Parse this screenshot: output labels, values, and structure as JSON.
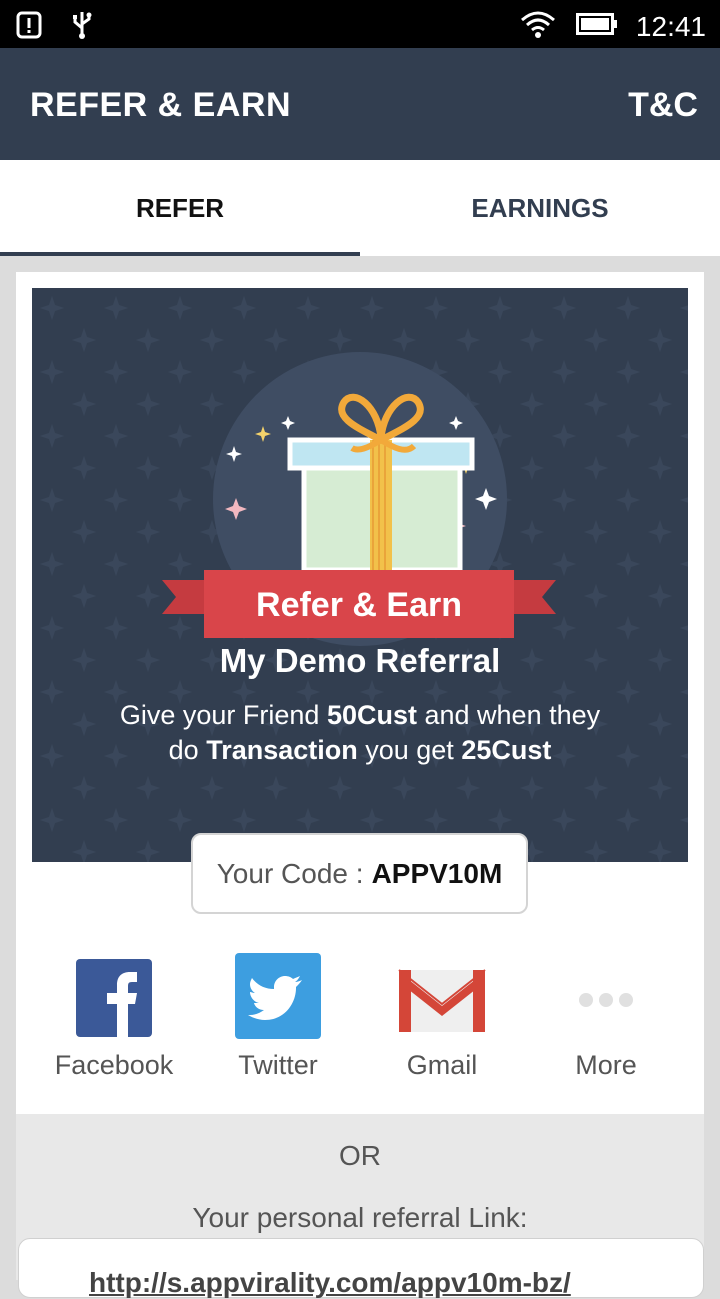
{
  "status_bar": {
    "time": "12:41"
  },
  "app_bar": {
    "title": "REFER & EARN",
    "action": "T&C"
  },
  "tabs": [
    {
      "label": "REFER"
    },
    {
      "label": "EARNINGS"
    }
  ],
  "banner": {
    "ribbon_text": "Refer & Earn",
    "title": "My Demo Referral",
    "desc": {
      "line1_a": "Give your Friend ",
      "line1_b": "50Cust",
      "line1_c": " and when they",
      "line2_a": "do ",
      "line2_b": "Transaction",
      "line2_c": " you get ",
      "line2_d": "25Cust"
    }
  },
  "code": {
    "label": "Your Code :",
    "value": "APPV10M"
  },
  "share": [
    {
      "label": "Facebook",
      "icon": "facebook-icon"
    },
    {
      "label": "Twitter",
      "icon": "twitter-icon"
    },
    {
      "label": "Gmail",
      "icon": "gmail-icon"
    },
    {
      "label": "More",
      "icon": "more-dots-icon"
    }
  ],
  "link_section": {
    "or": "OR",
    "label": "Your personal referral Link:",
    "url": "http://s.appvirality.com/appv10m-bz/"
  },
  "colors": {
    "primary": "#323e50",
    "ribbon": "#d9454a",
    "facebook": "#3b5998",
    "twitter": "#3d9ee0",
    "gmail": "#d44638"
  }
}
